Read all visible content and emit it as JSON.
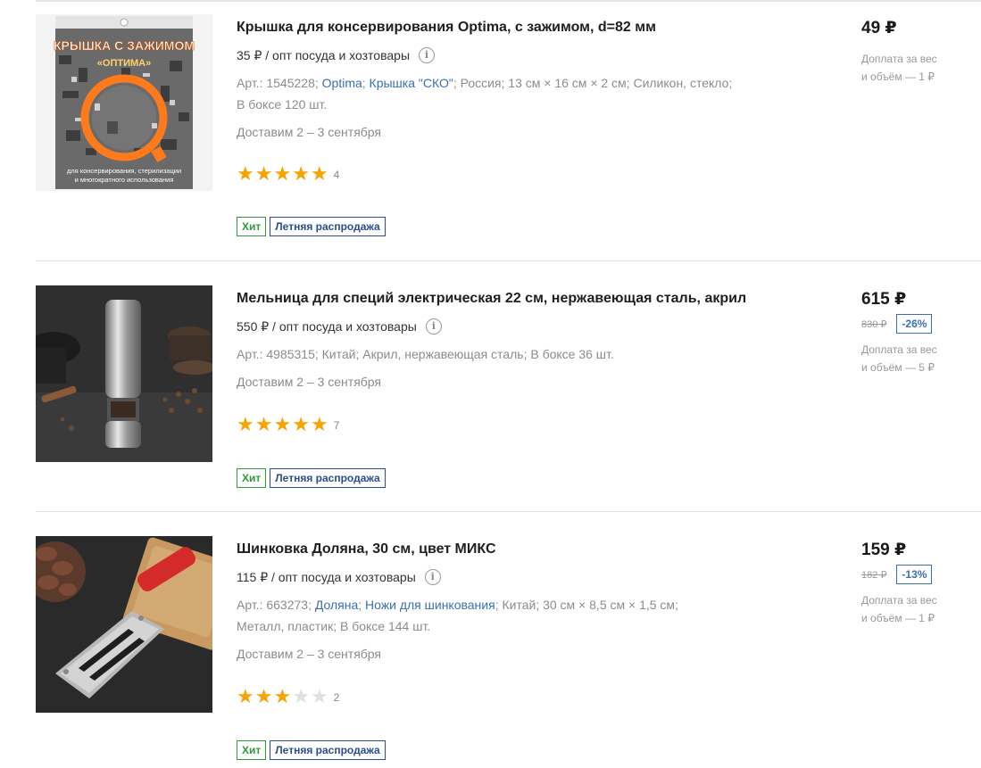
{
  "products": [
    {
      "title": "Крышка для консервирования Optima, с зажимом, d=82 мм",
      "opt_price": "35 ₽ / опт посуда и хозтовары",
      "meta_line1": [
        "Арт.: 1545228; ",
        "Optima",
        "; ",
        "Крышка \"СКО\"",
        "; Россия; 13 см × 16 см × 2 см; Силикон, стекло;"
      ],
      "meta_line2": "В боксе 120 шт.",
      "delivery": "Доставим 2 – 3 сентября",
      "rating": 5,
      "rating_count": "4",
      "badges": [
        "Хит",
        "Летняя распродажа"
      ],
      "price": "49 ₽",
      "old_price": "",
      "discount": "",
      "surcharge_1": "Доплата за вес",
      "surcharge_2": "и объём — 1 ₽",
      "image_text_1": "КРЫШКА С ЗАЖИМОМ",
      "image_text_2": "«ОПТИМА»",
      "image_text_3": "для консервирования, стерилизации",
      "image_text_4": "и многократного использования"
    },
    {
      "title": "Мельница для специй электрическая 22 см, нержавеющая сталь, акрил",
      "opt_price": "550 ₽ / опт посуда и хозтовары",
      "meta_line1": [
        "Арт.: 4985315; Китай; Акрил, нержавеющая сталь; В боксе 36 шт."
      ],
      "meta_line2": "",
      "delivery": "Доставим 2 – 3 сентября",
      "rating": 5,
      "rating_count": "7",
      "badges": [
        "Хит",
        "Летняя распродажа"
      ],
      "price": "615 ₽",
      "old_price": "830 ₽",
      "discount": "-26%",
      "surcharge_1": "Доплата за вес",
      "surcharge_2": "и объём — 5 ₽"
    },
    {
      "title": "Шинковка Доляна, 30 см, цвет МИКС",
      "opt_price": "115 ₽ / опт посуда и хозтовары",
      "meta_line1": [
        "Арт.: 663273; ",
        "Доляна",
        "; ",
        "Ножи для шинкования",
        "; Китай; 30 см × 8,5 см × 1,5 см;"
      ],
      "meta_line2": "Металл, пластик; В боксе 144 шт.",
      "delivery": "Доставим 2 – 3 сентября",
      "rating": 3,
      "rating_count": "2",
      "badges": [
        "Хит",
        "Летняя распродажа"
      ],
      "price": "159 ₽",
      "old_price": "182 ₽",
      "discount": "-13%",
      "surcharge_1": "Доплата за вес",
      "surcharge_2": "и объём — 1 ₽"
    }
  ],
  "colors": {
    "star": "#f5a400",
    "star_empty": "#e0e0e0",
    "link": "#3a6fb7",
    "hit": "#2f9b3a",
    "sale": "#2a4d8f"
  },
  "icons": {
    "info": "info-icon",
    "star": "star-icon"
  }
}
